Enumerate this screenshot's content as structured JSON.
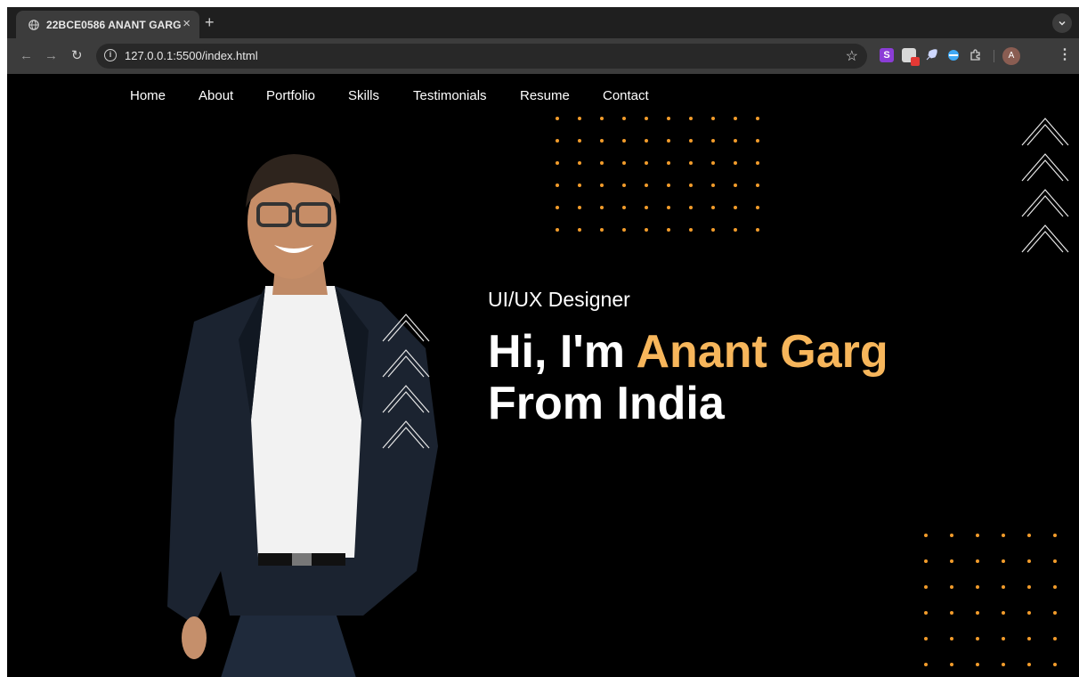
{
  "browser": {
    "tab_title": "22BCE0586 ANANT GARG",
    "tab_close": "×",
    "new_tab": "+",
    "url": "127.0.0.1:5500/index.html",
    "info_glyph": "i",
    "star_glyph": "☆",
    "back_glyph": "←",
    "forward_glyph": "→",
    "reload_glyph": "↻",
    "extension_s_label": "S",
    "avatar_initial": "A",
    "menu_glyph": "⋮"
  },
  "nav": {
    "home": "Home",
    "about": "About",
    "portfolio": "Portfolio",
    "skills": "Skills",
    "testimonials": "Testimonials",
    "resume": "Resume",
    "contact": "Contact"
  },
  "hero": {
    "role": "UI/UX Designer",
    "greeting": "Hi, I'm",
    "name": "Anant Garg",
    "origin": "From India"
  },
  "colors": {
    "accent": "#f7b65b",
    "dots": "#f29c2b",
    "background": "#000000"
  }
}
